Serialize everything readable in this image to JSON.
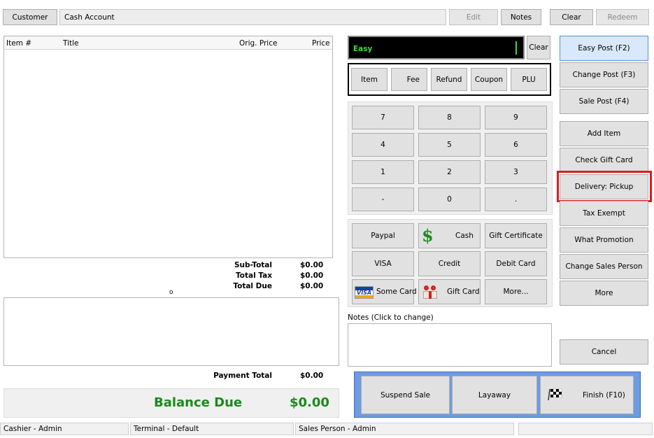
{
  "top": {
    "customer_label": "Customer",
    "customer_value": "Cash Account",
    "edit_label": "Edit",
    "notes_label": "Notes",
    "clear_label": "Clear",
    "redeem_label": "Redeem"
  },
  "items_table": {
    "columns": [
      "Item #",
      "Title",
      "Orig. Price",
      "Price"
    ]
  },
  "totals": {
    "subtotal_label": "Sub-Total",
    "subtotal_value": "$0.00",
    "tax_label": "Total Tax",
    "tax_value": "$0.00",
    "due_label": "Total Due",
    "due_value": "$0.00",
    "stray_mark": "o",
    "payment_total_label": "Payment Total",
    "payment_total_value": "$0.00",
    "balance_label": "Balance Due",
    "balance_value": "$0.00"
  },
  "entry": {
    "mode_text": "Easy",
    "clear_label": "Clear",
    "types": [
      "Item",
      "Fee",
      "Refund",
      "Coupon",
      "PLU"
    ]
  },
  "keypad": [
    "7",
    "8",
    "9",
    "4",
    "5",
    "6",
    "1",
    "2",
    "3",
    "-",
    "0",
    "."
  ],
  "tenders": {
    "paypal": "Paypal",
    "cash": "Cash",
    "gift_certificate": "Gift Certificate",
    "visa": "VISA",
    "credit": "Credit",
    "debit_card": "Debit Card",
    "some_card": "Some Card",
    "gift_card": "Gift Card",
    "more": "More...",
    "visa_logo_text": "VISA"
  },
  "notes": {
    "label": "Notes (Click to change)"
  },
  "actions": {
    "suspend": "Suspend Sale",
    "layaway": "Layaway",
    "finish": "Finish (F10)"
  },
  "side": {
    "easy_post": "Easy Post (F2)",
    "change_post": "Change Post (F3)",
    "sale_post": "Sale Post (F4)",
    "add_item": "Add Item",
    "check_gift_card": "Check Gift Card",
    "delivery": "Delivery: Pickup",
    "tax_exempt": "Tax Exempt",
    "what_promotion": "What Promotion",
    "change_sales_person": "Change Sales Person",
    "more": "More",
    "cancel": "Cancel"
  },
  "status": {
    "cashier": "Cashier - Admin",
    "terminal": "Terminal - Default",
    "sales_person": "Sales Person - Admin",
    "extra": ""
  },
  "colors": {
    "highlight_red": "#e01b1b",
    "balance_green": "#1a8a1a",
    "entry_bg": "#000000",
    "entry_text": "#3cdc3c",
    "action_bar_bg": "#6f9be0",
    "active_side_bg": "#d9e8fa"
  }
}
